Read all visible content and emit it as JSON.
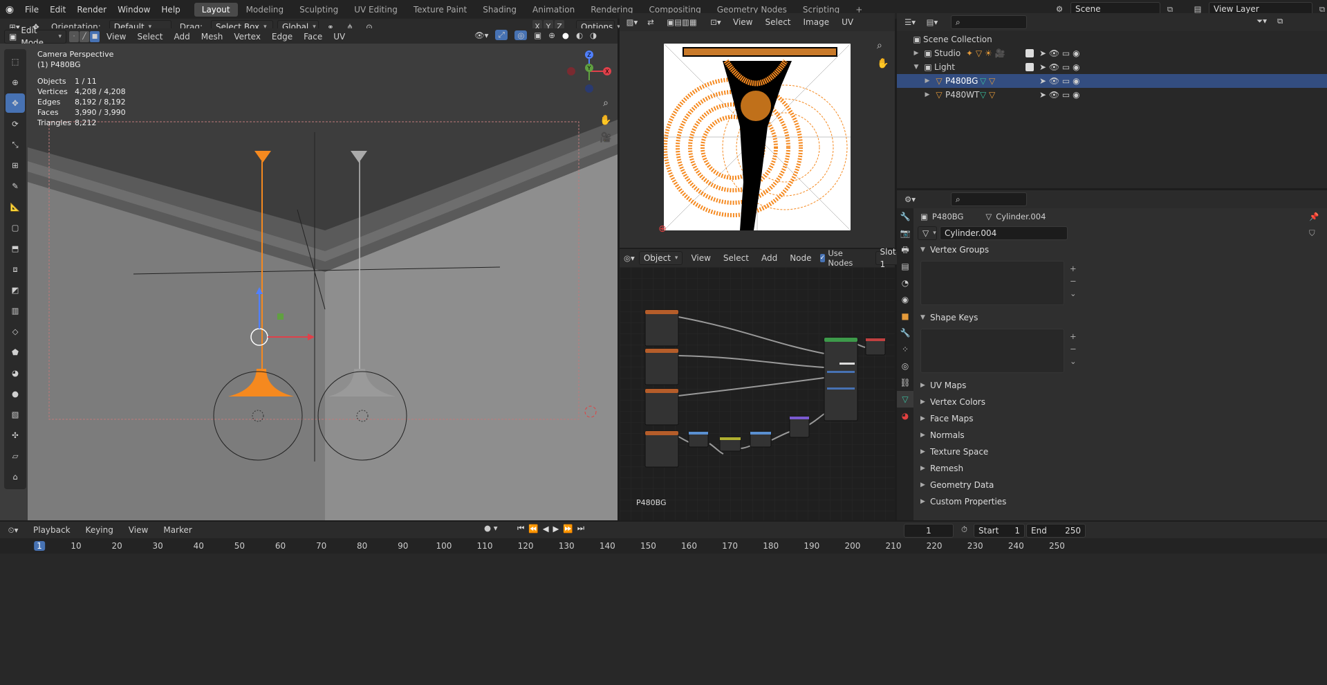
{
  "topbar": {
    "menus": [
      "File",
      "Edit",
      "Render",
      "Window",
      "Help"
    ],
    "workspaces": [
      "Layout",
      "Modeling",
      "Sculpting",
      "UV Editing",
      "Texture Paint",
      "Shading",
      "Animation",
      "Rendering",
      "Compositing",
      "Geometry Nodes",
      "Scripting"
    ],
    "active_workspace": "Layout",
    "add_tab": "+",
    "scene": "Scene",
    "view_layer": "View Layer"
  },
  "viewport": {
    "mode": "Edit Mode",
    "orientation_label": "Orientation:",
    "orientation": "Default",
    "drag_label": "Drag:",
    "drag": "Select Box",
    "transform_space": "Global",
    "menus": [
      "View",
      "Select",
      "Add",
      "Mesh",
      "Vertex",
      "Edge",
      "Face",
      "UV"
    ],
    "options": "Options",
    "axes": [
      "X",
      "Y",
      "Z"
    ],
    "overlay_title": "Camera Perspective",
    "overlay_object": "(1) P480BG",
    "stats": [
      {
        "k": "Objects",
        "v": "1 / 11"
      },
      {
        "k": "Vertices",
        "v": "4,208 / 4,208"
      },
      {
        "k": "Edges",
        "v": "8,192 / 8,192"
      },
      {
        "k": "Faces",
        "v": "3,990 / 3,990"
      },
      {
        "k": "Triangles",
        "v": "8,212"
      }
    ],
    "gizmo": {
      "x": "X",
      "y": "Y",
      "z": "Z"
    }
  },
  "image_editor": {
    "menus": [
      "View",
      "Select",
      "Image",
      "UV"
    ]
  },
  "node_editor": {
    "object_type": "Object",
    "menus": [
      "View",
      "Select",
      "Add",
      "Node"
    ],
    "use_nodes_label": "Use Nodes",
    "use_nodes": true,
    "slot": "Slot 1",
    "material_label": "P480BG"
  },
  "outliner": {
    "rows": [
      {
        "name": "Scene Collection",
        "indent": 0
      },
      {
        "name": "Studio",
        "indent": 1
      },
      {
        "name": "Light",
        "indent": 1
      },
      {
        "name": "P480BG",
        "indent": 2,
        "selected": true
      },
      {
        "name": "P480WT",
        "indent": 2
      }
    ]
  },
  "properties": {
    "object": "P480BG",
    "mesh": "Cylinder.004",
    "mesh_field": "Cylinder.004",
    "open_panels": [
      "Vertex Groups",
      "Shape Keys"
    ],
    "closed_panels": [
      "UV Maps",
      "Vertex Colors",
      "Face Maps",
      "Normals",
      "Texture Space",
      "Remesh",
      "Geometry Data",
      "Custom Properties"
    ]
  },
  "timeline": {
    "menus": [
      "Playback",
      "Keying",
      "View",
      "Marker"
    ],
    "current_frame": "1",
    "start_label": "Start",
    "start": "1",
    "end_label": "End",
    "end": "250",
    "ticks": [
      "1",
      "10",
      "20",
      "30",
      "40",
      "50",
      "60",
      "70",
      "80",
      "90",
      "100",
      "110",
      "120",
      "130",
      "140",
      "150",
      "160",
      "170",
      "180",
      "190",
      "200",
      "210",
      "220",
      "230",
      "240",
      "250"
    ]
  },
  "colors": {
    "accent": "#4772b3",
    "selection": "#f5891f",
    "active_tab": "#4a4a4a"
  }
}
